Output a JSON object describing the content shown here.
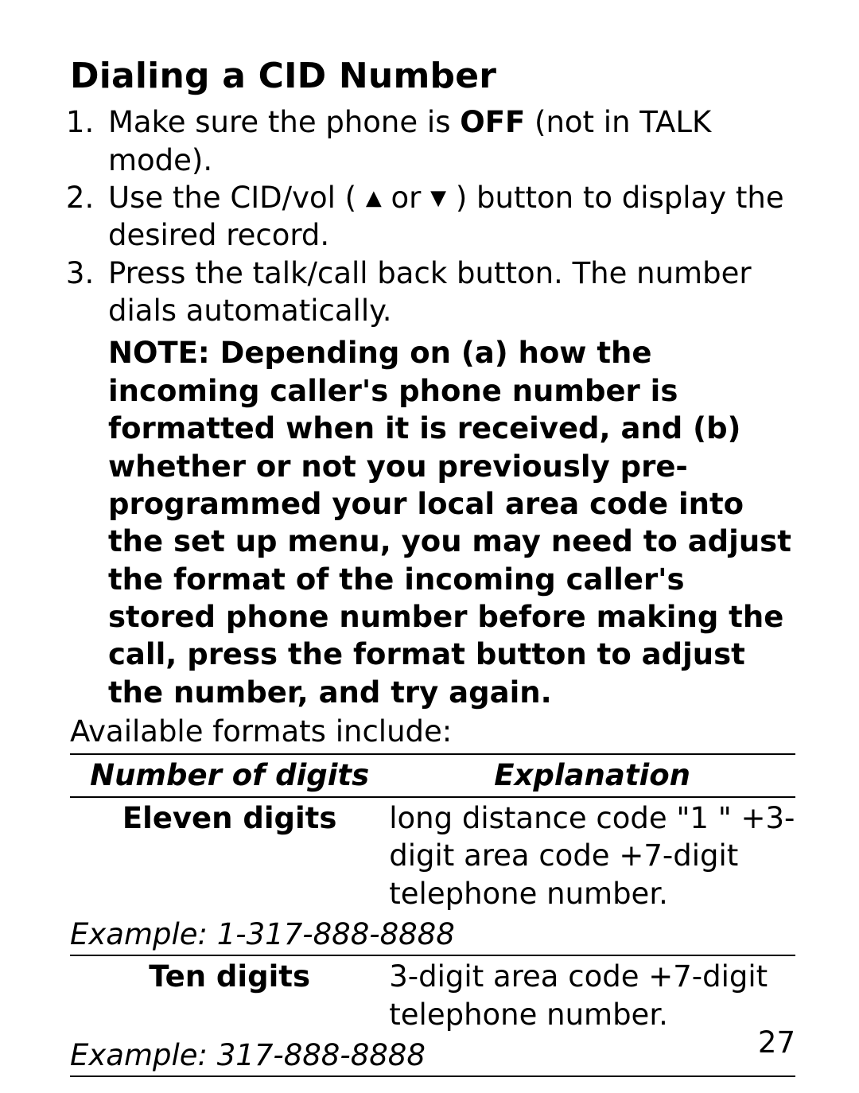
{
  "heading": "Dialing a CID Number",
  "steps": {
    "s1_a": "Make sure the phone is ",
    "s1_off": "OFF",
    "s1_b": " (not in TALK mode).",
    "s2_a": "Use the CID/vol ( ",
    "s2_b": " or ",
    "s2_c": " ) button to display the desired record.",
    "s3": "Press the talk/call back button. The number dials automatically.",
    "note": "NOTE: Depending on (a) how the incoming caller's phone number is formatted when it is received, and (b) whether or not you previously pre-programmed your local area code into the set up menu, you may need to adjust the format of the incoming caller's stored phone number before making the call, press the format button to adjust the number, and try again."
  },
  "formats_intro": "Available formats include:",
  "table": {
    "header_left": "Number of digits",
    "header_right": "Explanation",
    "rows": [
      {
        "digits": "Eleven digits",
        "explanation": "long distance code \"1 \" +3-digit area code +7-digit telephone number.",
        "example": "Example: 1-317-888-8888"
      },
      {
        "digits": "Ten digits",
        "explanation": "3-digit area code +7-digit telephone number.",
        "example": "Example: 317-888-8888"
      }
    ]
  },
  "page_number": "27"
}
